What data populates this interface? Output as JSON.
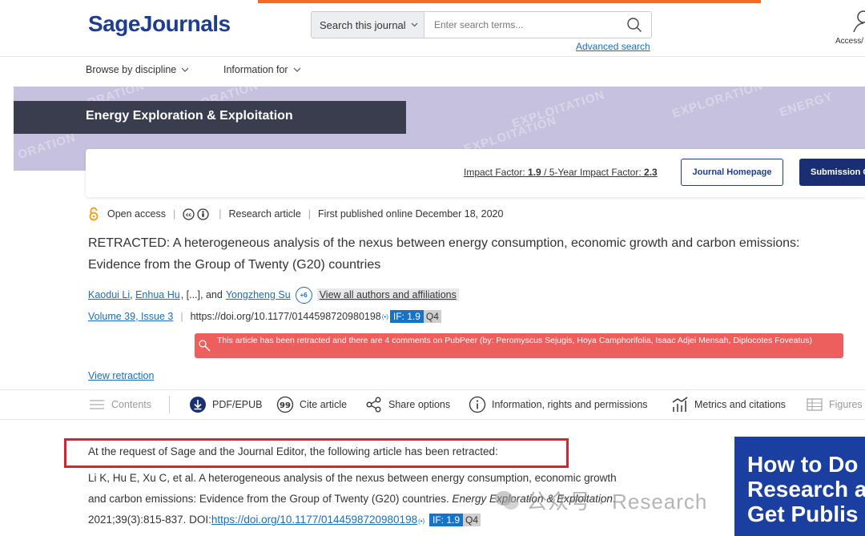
{
  "header": {
    "logo": "SageJournals",
    "search_scope": "Search this journal",
    "search_placeholder": "Enter search terms...",
    "advanced_search": "Advanced search",
    "access_label": "Access/"
  },
  "nav": [
    {
      "label": "Browse by discipline"
    },
    {
      "label": "Information for"
    }
  ],
  "journal": {
    "title": "Energy Exploration & Exploitation",
    "banner_words": [
      "EXPLORATION",
      "EXPLORATION",
      "ORATION",
      "EXPLOITATION",
      "EXPLOITATION",
      "EXPLORATION",
      "ENERGY"
    ],
    "impact_factor_label": "Impact Factor:",
    "impact_factor": "1.9",
    "five_year_label": "/ 5-Year Impact Factor:",
    "five_year": "2.3",
    "homepage_button": "Journal Homepage",
    "submission_button": "Submission G"
  },
  "article": {
    "access": "Open access",
    "type": "Research article",
    "first_published": "First published online December 18, 2020",
    "title": "RETRACTED: A heterogeneous analysis of the nexus between energy consumption, economic growth and carbon emissions: Evidence from the Group of Twenty (G20) countries",
    "authors": {
      "author1": "Kaodui Li",
      "author2": "Enhua Hu",
      "ellipsis": ", [...], and",
      "author_last": "Yongzheng Su",
      "more_count": "+6",
      "view_all": "View all authors and affiliations"
    },
    "volume": "Volume 39, Issue 3",
    "doi": "https://doi.org/10.1177/0144598720980198",
    "if_badge": "IF: 1.9",
    "quartile": "Q4",
    "retraction_alert": "This article has been retracted and there are 4 comments on PubPeer (by: Peromyscus Sejugis, Hoya Camphorifolia, Isaac Adjei Mensah, Diplocotes Foveatus)",
    "view_retraction": "View retraction"
  },
  "toolbar": {
    "contents": "Contents",
    "pdf": "PDF/EPUB",
    "cite": "Cite article",
    "share": "Share options",
    "info": "Information, rights and permissions",
    "metrics": "Metrics and citations",
    "figures": "Figures a"
  },
  "notice": {
    "intro": "At the request of Sage and the Journal Editor, the following article has been retracted:",
    "citation_main": "Li K, Hu E, Xu C, et al. A heterogeneous analysis of the nexus between energy consumption, economic growth and carbon emissions: Evidence from the Group of Twenty (G20) countries.",
    "citation_journal": "Energy Exploration & Exploitation",
    "citation_year": ". 2021;39(3):815-837. DOI:",
    "citation_doi": "https://doi.org/10.1177/0144598720980198",
    "if_badge": "IF: 1.9",
    "quartile": "Q4"
  },
  "watermark": "公众号 · Research",
  "ad": {
    "line1": "How to Do",
    "line2": "Research a",
    "line3": "Get Publis"
  },
  "colors": {
    "brand": "#1d3d8f",
    "accent": "#f26b21",
    "link": "#1a6fb8",
    "alert": "#ed5f5d",
    "highlight_box": "#e0202a"
  }
}
